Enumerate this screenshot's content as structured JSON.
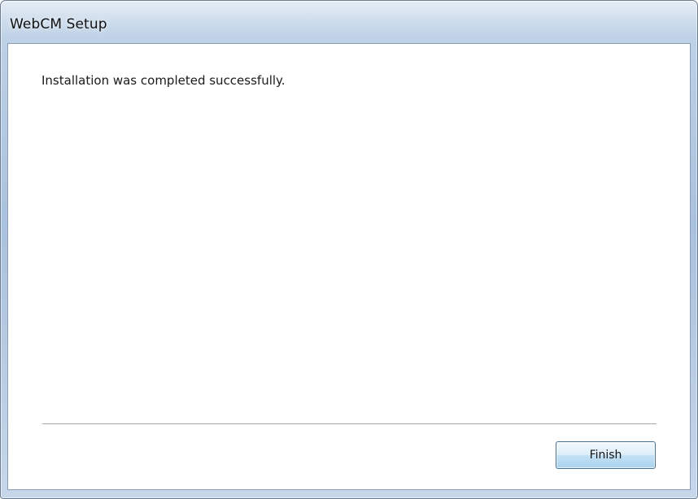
{
  "window": {
    "title": "WebCM Setup"
  },
  "content": {
    "message": "Installation was completed successfully."
  },
  "buttons": {
    "finish_label": "Finish"
  },
  "colors": {
    "frame": "#a9c2dd",
    "client_background": "#ffffff",
    "button_gradient_top": "#f2f9fd",
    "button_gradient_bottom": "#a9d2ee",
    "button_border": "#4a6f91"
  }
}
